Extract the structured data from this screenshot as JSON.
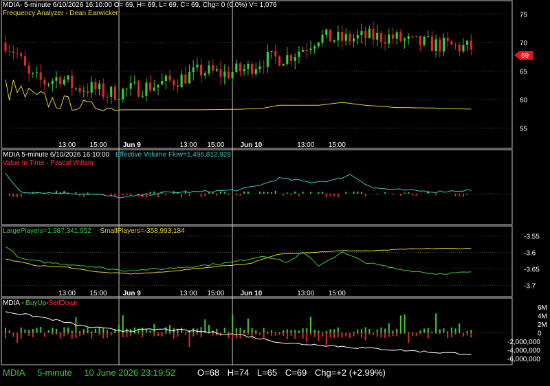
{
  "colors": {
    "background": "#000000",
    "grid": "#444444",
    "frame": "#c8c8c8",
    "up": "#3ccc3c",
    "down": "#e02828",
    "yellow": "#e6d23c",
    "cyan": "#3cc8c8",
    "white": "#ffffff",
    "price_tag": "#e01818"
  },
  "panel1": {
    "title": "MDIA- 5-minute 6/10/2026 16:10:00 O= 69, H= 69, L= 69, C= 69, Chg= 0 (0.0%) V= 1,076",
    "indicator": "Frequency Analyzer - Dean Earwicker",
    "price_tag": "69"
  },
  "panel2": {
    "title": "MDIA 5-minute  6/10/2026 16:10:00",
    "indicator_value": "Effective Volume Flow=1,496,812,928",
    "indicator2": "Value In Time - Pascal Willain"
  },
  "panel3": {
    "large_players": "LargePlayers=1,987,341,952",
    "small_players": "SmallPlayers=-358,993,184"
  },
  "panel4": {
    "prefix": "MDIA - ",
    "buy": "BuyUp",
    "sep": "-",
    "sell": "SellDown"
  },
  "status": {
    "symbol": "MDIA",
    "interval": "5-minute",
    "datetime": "10 June 2026 23:19:52",
    "open": "O=68",
    "high": "H=74",
    "low": "L=65",
    "close": "C=69",
    "chg": "Chg=+2 (+2.99%)"
  },
  "chart_data": [
    {
      "type": "candlestick",
      "title": "MDIA- 5-minute",
      "x_tick_labels": [
        "13:00",
        "15:00",
        "Jun 9",
        "13:00",
        "15:00",
        "Jun 10",
        "13:00",
        "15:00"
      ],
      "y_tick_labels": [
        "55",
        "60",
        "65",
        "70",
        "75"
      ],
      "ylim": [
        53,
        77
      ],
      "last_price": 69,
      "close_path": [
        [
          0,
          70
        ],
        [
          3,
          68
        ],
        [
          6,
          64
        ],
        [
          10,
          63
        ],
        [
          14,
          64
        ],
        [
          18,
          62
        ],
        [
          22,
          62
        ],
        [
          26,
          61
        ],
        [
          30,
          61.5
        ],
        [
          34,
          62
        ],
        [
          38,
          62.5
        ],
        [
          44,
          63.5
        ],
        [
          50,
          65
        ],
        [
          56,
          64.5
        ],
        [
          62,
          65.5
        ],
        [
          66,
          67
        ],
        [
          72,
          67.5
        ],
        [
          76,
          69
        ],
        [
          80,
          71
        ],
        [
          86,
          70.5
        ],
        [
          92,
          71
        ],
        [
          98,
          71
        ],
        [
          104,
          70
        ],
        [
          112,
          69.5
        ],
        [
          120,
          69
        ]
      ],
      "series": [
        {
          "name": "Frequency Analyzer",
          "values_path": [
            [
              0,
              62
            ],
            [
              8,
              60
            ],
            [
              20,
              59
            ],
            [
              30,
              58.2
            ],
            [
              40,
              58.2
            ],
            [
              50,
              58.2
            ],
            [
              60,
              58.3
            ],
            [
              66,
              58.5
            ],
            [
              70,
              59
            ],
            [
              80,
              59
            ],
            [
              86,
              59.5
            ],
            [
              92,
              59
            ],
            [
              100,
              58.6
            ],
            [
              110,
              58.5
            ],
            [
              120,
              58.3
            ]
          ]
        }
      ]
    },
    {
      "type": "line",
      "title": "MDIA 5-minute",
      "series": [
        {
          "name": "Effective Volume Flow",
          "values_path": [
            [
              0,
              1
            ],
            [
              4,
              0.1
            ],
            [
              10,
              0.05
            ],
            [
              20,
              0
            ],
            [
              30,
              -0.2
            ],
            [
              40,
              0.05
            ],
            [
              50,
              0.1
            ],
            [
              60,
              0.2
            ],
            [
              66,
              0.5
            ],
            [
              70,
              0.8
            ],
            [
              78,
              0.6
            ],
            [
              84,
              0.7
            ],
            [
              88,
              1
            ],
            [
              94,
              0.3
            ],
            [
              100,
              0.2
            ],
            [
              110,
              0.1
            ],
            [
              120,
              0.2
            ]
          ]
        },
        {
          "name": "Value In Time",
          "bars": "centered"
        }
      ]
    },
    {
      "type": "line",
      "y_tick_labels": [
        "-3.55",
        "-3.6",
        "-3.65",
        "-3.7"
      ],
      "ylim": [
        -3.72,
        -3.53
      ],
      "series": [
        {
          "name": "LargePlayers",
          "values_path": [
            [
              0,
              -3.62
            ],
            [
              8,
              -3.64
            ],
            [
              16,
              -3.645
            ],
            [
              24,
              -3.66
            ],
            [
              32,
              -3.665
            ],
            [
              40,
              -3.66
            ],
            [
              48,
              -3.65
            ],
            [
              56,
              -3.64
            ],
            [
              62,
              -3.635
            ],
            [
              66,
              -3.62
            ],
            [
              70,
              -3.605
            ],
            [
              78,
              -3.6
            ],
            [
              86,
              -3.595
            ],
            [
              94,
              -3.595
            ],
            [
              102,
              -3.59
            ],
            [
              110,
              -3.588
            ],
            [
              120,
              -3.588
            ]
          ]
        },
        {
          "name": "SmallPlayers",
          "values_path": [
            [
              0,
              -3.58
            ],
            [
              4,
              -3.62
            ],
            [
              10,
              -3.63
            ],
            [
              20,
              -3.64
            ],
            [
              30,
              -3.655
            ],
            [
              40,
              -3.65
            ],
            [
              50,
              -3.64
            ],
            [
              58,
              -3.63
            ],
            [
              66,
              -3.61
            ],
            [
              72,
              -3.63
            ],
            [
              76,
              -3.6
            ],
            [
              80,
              -3.64
            ],
            [
              86,
              -3.6
            ],
            [
              92,
              -3.63
            ],
            [
              100,
              -3.65
            ],
            [
              110,
              -3.665
            ],
            [
              120,
              -3.66
            ]
          ]
        }
      ]
    },
    {
      "type": "bar",
      "y_tick_labels": [
        "6M",
        "4M",
        "2M",
        "0",
        "-2,000,000",
        "-4,000,000",
        "-6,000,000"
      ],
      "ylim": [
        -7000000,
        7000000
      ],
      "series": [
        {
          "name": "BuyUp"
        },
        {
          "name": "SellDown"
        },
        {
          "name": "Cumulative",
          "values_path": [
            [
              0,
              5000000
            ],
            [
              10,
              3500000
            ],
            [
              20,
              1500000
            ],
            [
              30,
              500000
            ],
            [
              40,
              800000
            ],
            [
              50,
              300000
            ],
            [
              60,
              -500000
            ],
            [
              66,
              -1500000
            ],
            [
              72,
              -2500000
            ],
            [
              80,
              -2800000
            ],
            [
              90,
              -3500000
            ],
            [
              100,
              -4000000
            ],
            [
              110,
              -4600000
            ],
            [
              120,
              -5000000
            ]
          ]
        }
      ]
    }
  ]
}
